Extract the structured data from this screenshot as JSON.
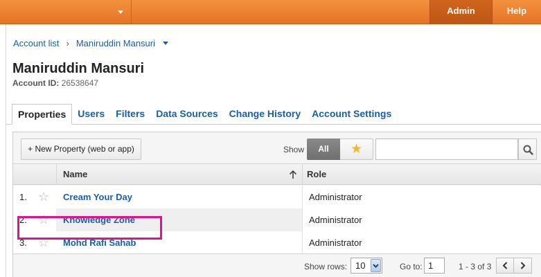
{
  "topbar": {
    "admin_label": "Admin",
    "help_label": "Help"
  },
  "breadcrumb": {
    "account_list": "Account list",
    "separator": "›",
    "account_name": "Maniruddin Mansuri"
  },
  "header": {
    "title": "Maniruddin Mansuri",
    "account_id_label": "Account ID:",
    "account_id_value": "26538647"
  },
  "tabs": [
    {
      "label": "Properties",
      "active": true
    },
    {
      "label": "Users"
    },
    {
      "label": "Filters"
    },
    {
      "label": "Data Sources"
    },
    {
      "label": "Change History"
    },
    {
      "label": "Account Settings"
    }
  ],
  "toolbar": {
    "new_property_label": "+ New Property (web or app)",
    "show_label": "Show",
    "filter_all_label": "All",
    "filter_starred_icon": "star-icon",
    "search_placeholder": "",
    "search_icon": "search-icon"
  },
  "table": {
    "columns": [
      "Name",
      "Role"
    ],
    "sort": {
      "column": "Name",
      "direction": "ascending"
    },
    "rows": [
      {
        "num": "1.",
        "name": "Cream Your Day",
        "role": "Administrator",
        "starred": false,
        "highlighted": true
      },
      {
        "num": "2.",
        "name": "Knowledge Zone",
        "role": "Administrator",
        "starred": false
      },
      {
        "num": "3.",
        "name": "Mohd Rafi Sahab",
        "role": "Administrator",
        "starred": false
      }
    ]
  },
  "footer": {
    "show_rows_label": "Show rows:",
    "show_rows_value": "10",
    "goto_label": "Go to:",
    "goto_value": "1",
    "range_label": "1 - 3 of 3"
  },
  "colors": {
    "topbar": "#e8792b",
    "link": "#1a5ea8",
    "highlight": "#e0138c",
    "star": "#f1b82d"
  }
}
